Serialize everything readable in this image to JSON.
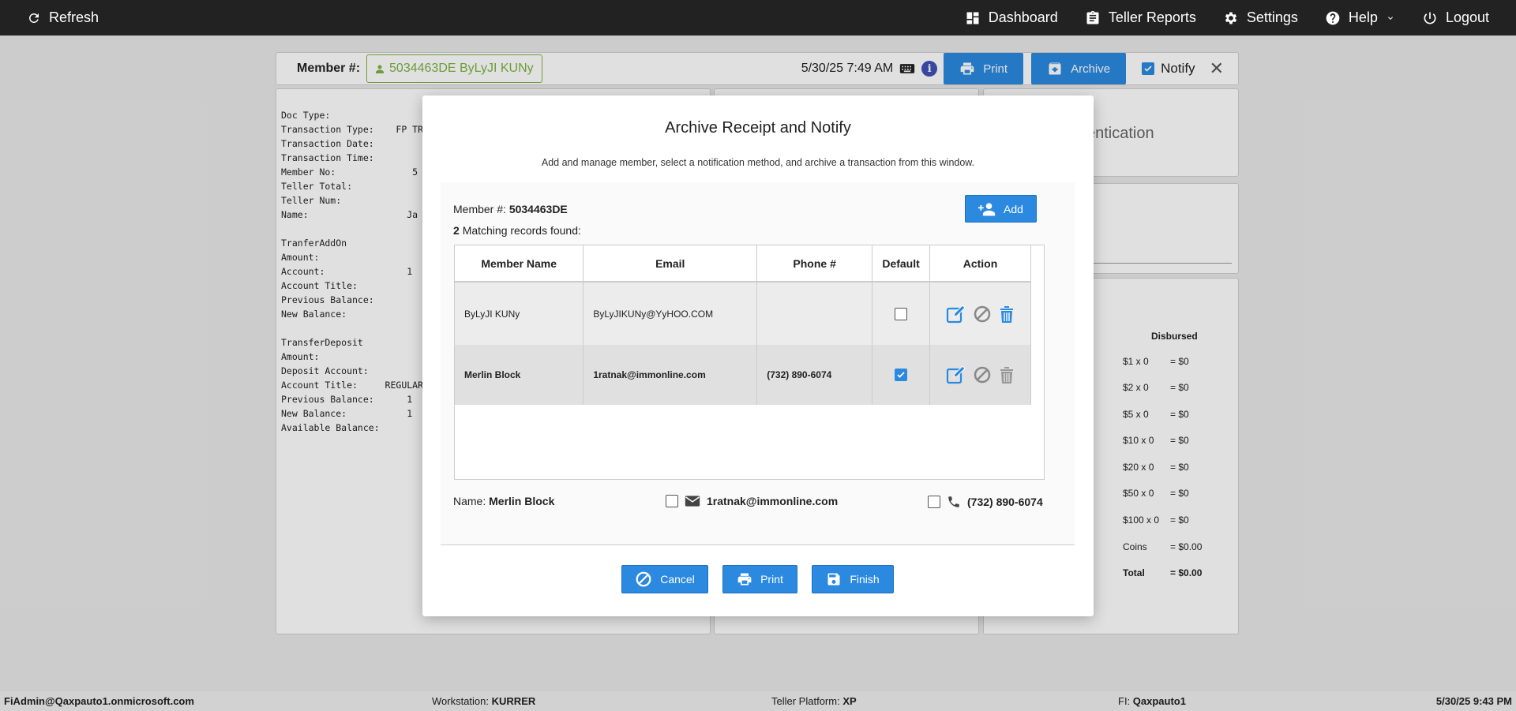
{
  "topbar": {
    "refresh": "Refresh",
    "dashboard": "Dashboard",
    "teller_reports": "Teller Reports",
    "settings": "Settings",
    "help": "Help",
    "logout": "Logout"
  },
  "member_bar": {
    "label": "Member #:",
    "member_value": "5034463DE ByLyJI KUNy",
    "datetime": "5/30/25 7:49 AM",
    "print": "Print",
    "archive": "Archive",
    "notify": "Notify",
    "close": "✕"
  },
  "receipt_lines": [
    "Doc Type:",
    "Transaction Type:    FP TRA",
    "Transaction Date:",
    "Transaction Time:",
    "Member No:              5",
    "Teller Total:",
    "Teller Num:",
    "Name:                  Ja",
    "",
    "TranferAddOn",
    "Amount:",
    "Account:               1",
    "Account Title:",
    "Previous Balance:",
    "New Balance:",
    "",
    "TransferDeposit",
    "Amount:",
    "Deposit Account:",
    "Account Title:     REGULAR",
    "Previous Balance:      1",
    "New Balance:           1",
    "Available Balance:"
  ],
  "auth_text": "entication",
  "cash": {
    "header": "Disbursed",
    "rows": [
      {
        "denom": "$1 x 0",
        "amount": "= $0"
      },
      {
        "denom": "$2 x 0",
        "amount": "= $0"
      },
      {
        "denom": "$5 x 0",
        "amount": "= $0"
      },
      {
        "denom": "$10 x 0",
        "amount": "= $0"
      },
      {
        "denom": "$20 x 0",
        "amount": "= $0"
      },
      {
        "denom": "$50 x 0",
        "amount": "= $0"
      },
      {
        "denom": "$100 x 0",
        "amount": "= $0"
      },
      {
        "denom": "Coins",
        "amount": "= $0.00"
      },
      {
        "denom": "Total",
        "amount": "= $0.00"
      }
    ]
  },
  "footer": {
    "user": "FiAdmin@Qaxpauto1.onmicrosoft.com",
    "workstation_label": "Workstation:",
    "workstation": "KURRER",
    "platform_label": "Teller Platform:",
    "platform": "XP",
    "fi_label": "FI:",
    "fi": "Qaxpauto1",
    "timestamp": "5/30/25 9:43 PM"
  },
  "modal": {
    "title": "Archive Receipt and Notify",
    "subtitle": "Add and manage member, select a notification method, and archive a transaction from this window.",
    "member_label": "Member #:",
    "member_no": "5034463DE",
    "match_count": "2",
    "match_text": "Matching records found:",
    "add": "Add",
    "columns": [
      "Member Name",
      "Email",
      "Phone #",
      "Default",
      "Action"
    ],
    "rows": [
      {
        "name": "ByLyJI KUNy",
        "email": "ByLyJIKUNy@YyHOO.COM",
        "phone": "",
        "default": false
      },
      {
        "name": "Merlin Block",
        "email": "1ratnak@immonline.com",
        "phone": "(732) 890-6074",
        "default": true
      }
    ],
    "name_label": "Name:",
    "selected_name": "Merlin Block",
    "selected_email": "1ratnak@immonline.com",
    "selected_phone": "(732) 890-6074",
    "cancel": "Cancel",
    "print": "Print",
    "finish": "Finish"
  },
  "colors": {
    "accent": "#2b8ae0",
    "member_green": "#7cb342",
    "topbar": "#222222"
  }
}
